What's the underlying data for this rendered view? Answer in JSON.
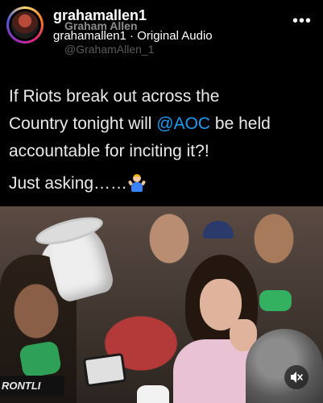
{
  "header": {
    "username": "grahamallen1",
    "audio_line": "grahamallen1 · Original Audio",
    "ghost_name": "Graham Allen",
    "ghost_handle": "@GrahamAllen_1",
    "more_icon": "more-options-icon"
  },
  "post": {
    "line1": "If Riots break out across the",
    "line2_pre": "Country tonight will ",
    "mention": "@AOC",
    "line2_post": " be held",
    "line3": "accountable for inciting it?!",
    "line4": "Just asking……",
    "emoji": "shrug-emoji-icon",
    "mention_color": "#1d9bf0"
  },
  "video": {
    "overlay_text": "RONTLI",
    "mute_icon": "mute-icon"
  }
}
